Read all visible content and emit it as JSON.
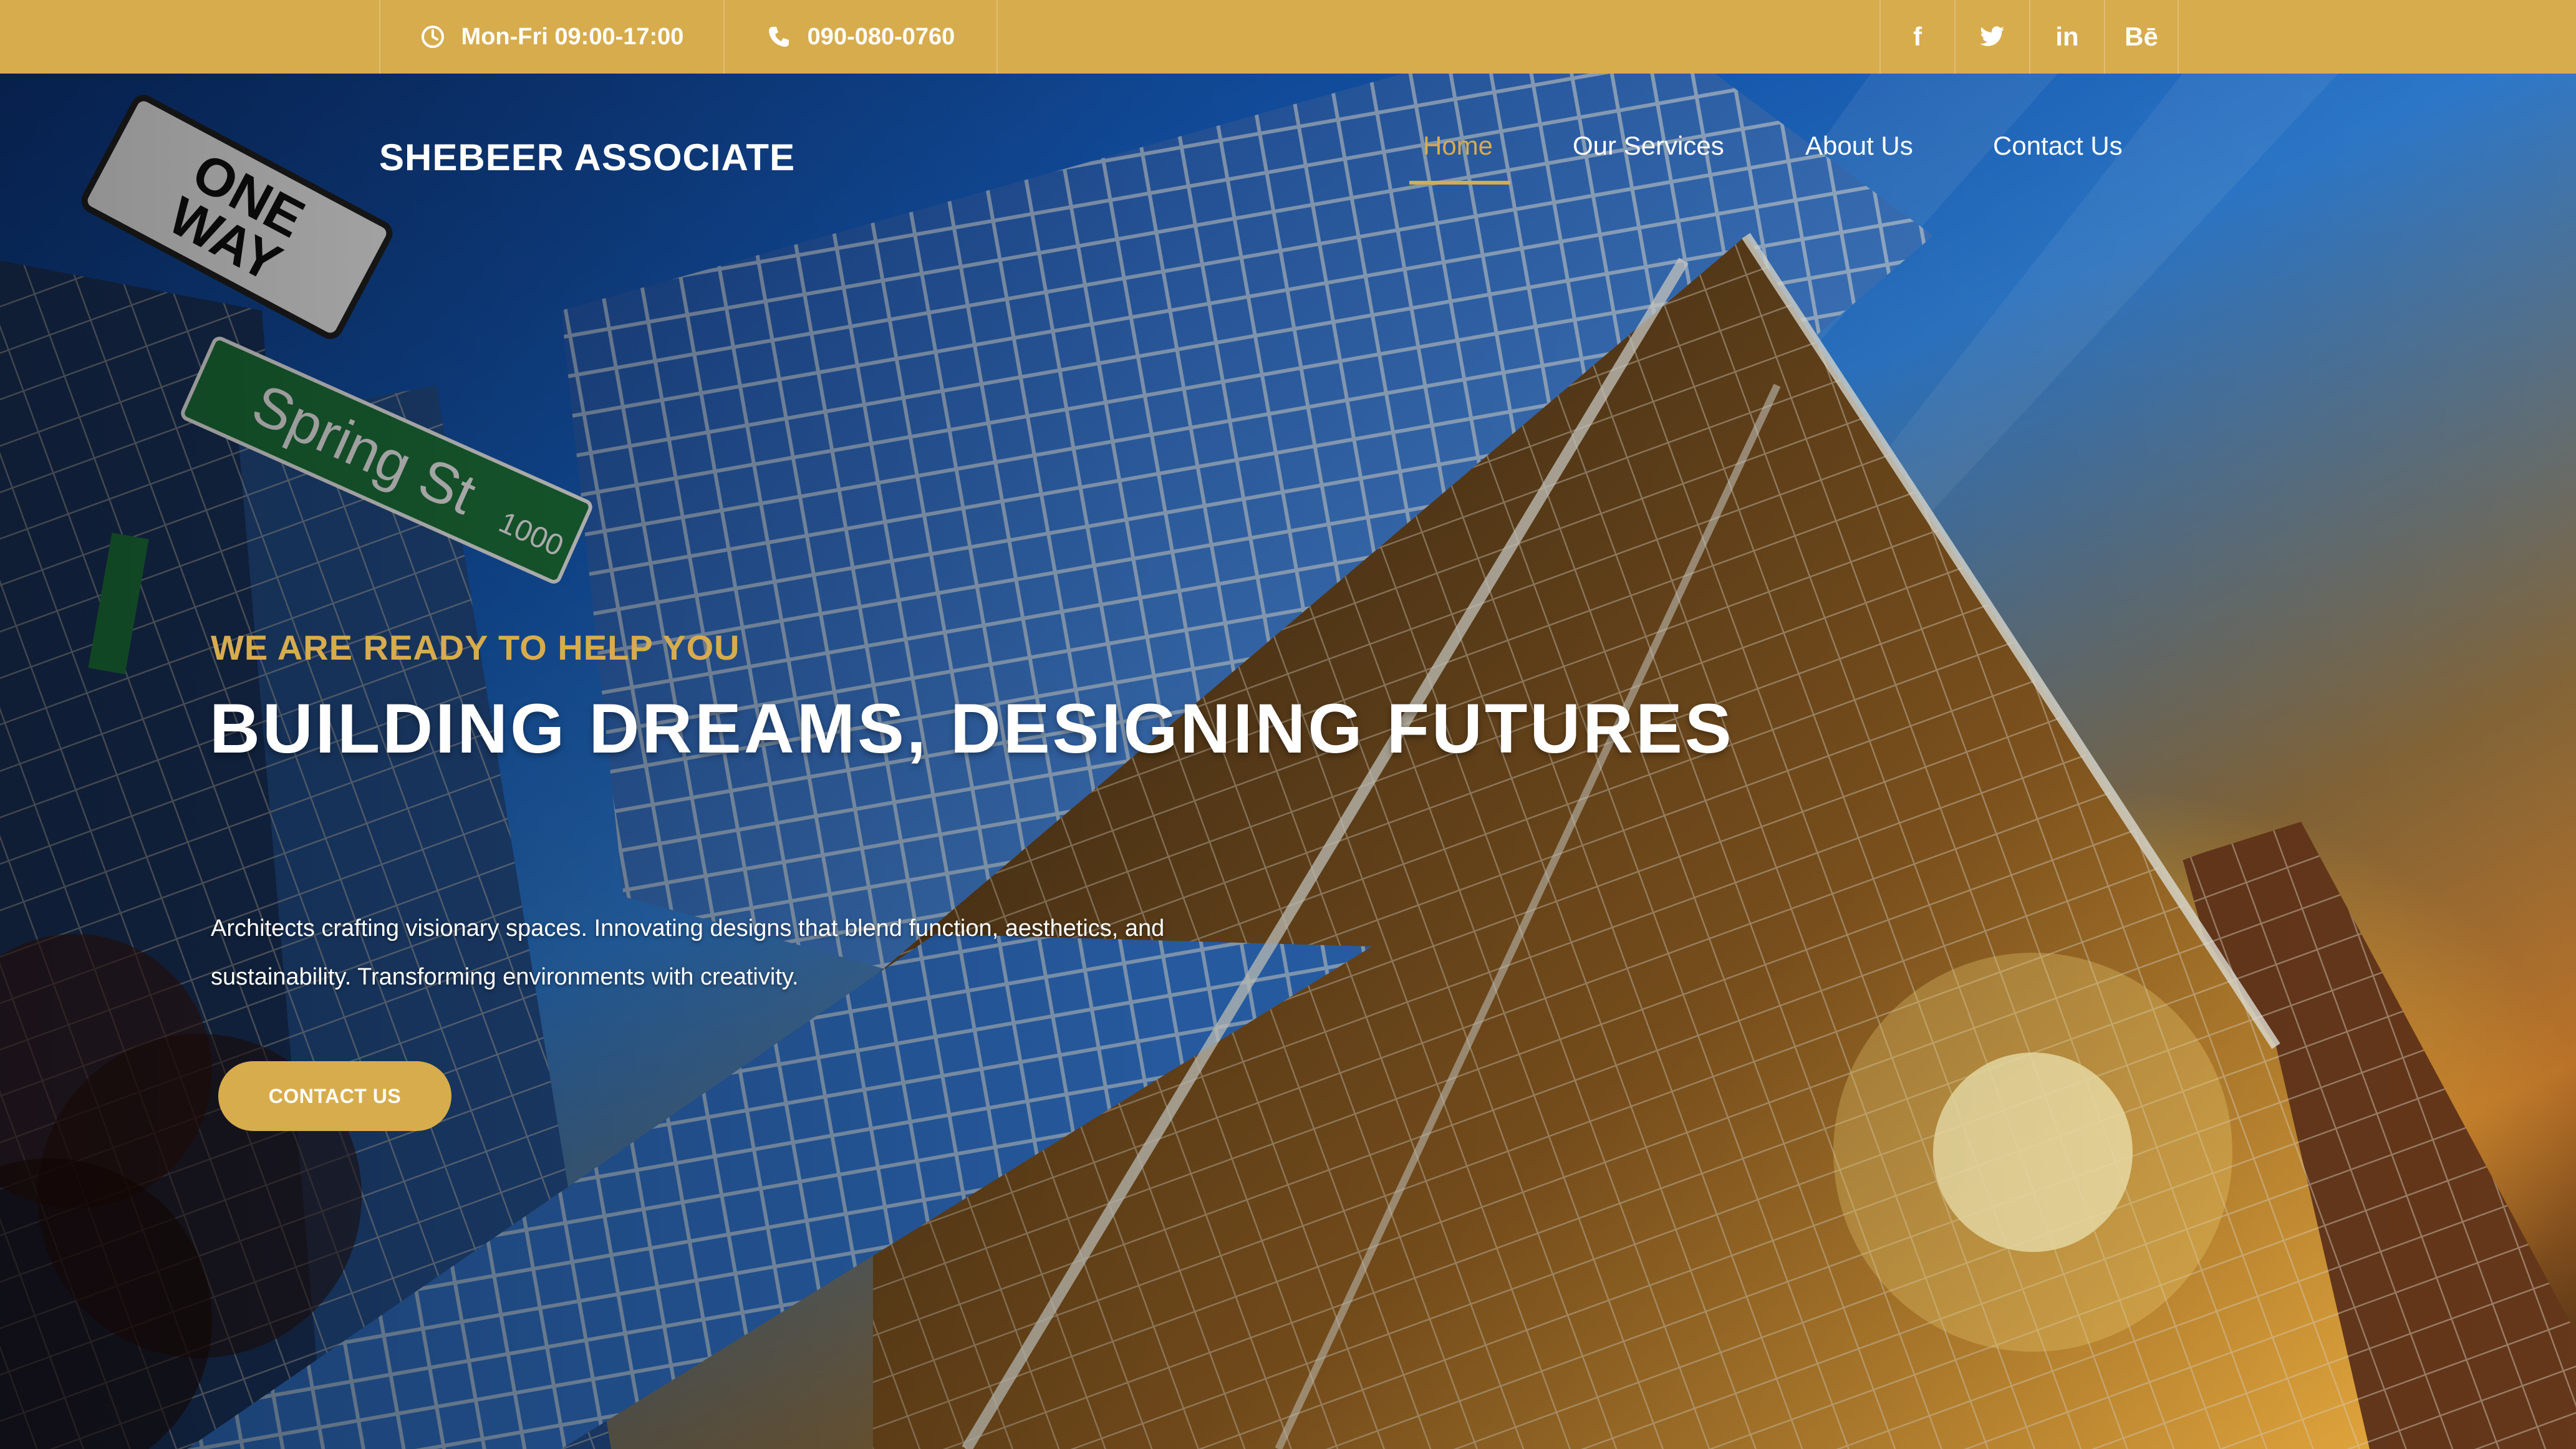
{
  "topbar": {
    "hours": "Mon-Fri 09:00-17:00",
    "phone": "090-080-0760",
    "hours_icon": "clock-icon",
    "phone_icon": "phone-icon",
    "social": [
      {
        "name": "facebook-icon",
        "label": "f"
      },
      {
        "name": "twitter-icon",
        "label": ""
      },
      {
        "name": "linkedin-icon",
        "label": "in"
      },
      {
        "name": "behance-icon",
        "label": "Bē"
      }
    ]
  },
  "header": {
    "brand": "SHEBEER ASSOCIATE",
    "nav": [
      {
        "label": "Home",
        "active": true
      },
      {
        "label": "Our Services"
      },
      {
        "label": "About Us"
      },
      {
        "label": "Contact Us"
      }
    ]
  },
  "hero": {
    "kicker": "WE ARE READY TO HELP YOU",
    "headline": "BUILDING DREAMS, DESIGNING FUTURES",
    "description": "Architects crafting visionary spaces. Innovating designs that blend function, aesthetics, and sustainability. Transforming environments with creativity.",
    "cta": "CONTACT US",
    "street_sign_1": "ONE WAY",
    "street_sign_2": "Spring St",
    "street_sign_number": "1000"
  },
  "colors": {
    "accent": "#d7ac4d",
    "text": "#ffffff"
  }
}
